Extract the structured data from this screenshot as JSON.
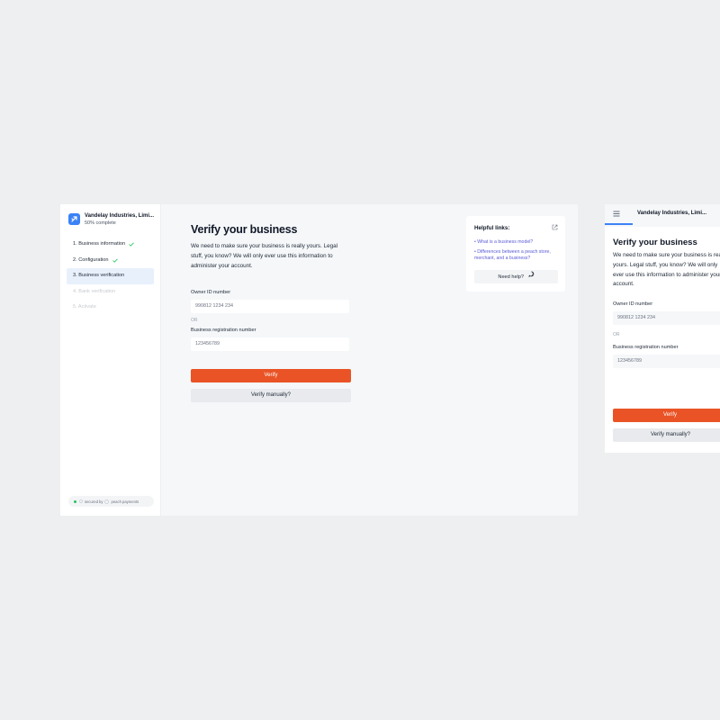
{
  "app": {
    "business_name": "Vandelay Industries, Limi...",
    "progress_text": "50% complete"
  },
  "steps": [
    {
      "label": "1.  Business information",
      "status": "complete"
    },
    {
      "label": "2.  Configuration",
      "status": "complete"
    },
    {
      "label": "3.  Business verification",
      "status": "active"
    },
    {
      "label": "4.  Bank verification",
      "status": "disabled"
    },
    {
      "label": "5.  Activate",
      "status": "disabled"
    }
  ],
  "footer": {
    "secured_by": "secured by",
    "provider": "peach payments"
  },
  "main": {
    "title": "Verify your business",
    "description": "We need to make sure your business is really yours. Legal stuff, you know? We will only ever use this information to administer your account.",
    "owner_id_label": "Owner ID number",
    "owner_id_placeholder": "990812 1234 234",
    "or_text": "OR",
    "registration_label": "Business registration number",
    "registration_placeholder": "123456789",
    "verify_label": "Verify",
    "verify_manually_label": "Verify manually?"
  },
  "help": {
    "title": "Helpful links:",
    "links": [
      "• What is a business model?",
      "• Differences between a peach store, merchant, and a business?"
    ],
    "need_help_label": "Need help?"
  },
  "mobile": {
    "brand": "Vandelay Industries, Limi...",
    "title": "Verify your business",
    "description": "We need to make sure your business is really yours. Legal stuff, you know? We will only ever use this information to administer your account.",
    "owner_id_label": "Owner ID number",
    "owner_id_placeholder": "990812 1234 234",
    "or_text": "OR",
    "registration_label": "Business registration number",
    "registration_placeholder": "123456789",
    "verify_label": "Verify",
    "verify_manually_label": "Verify manually?"
  },
  "colors": {
    "accent": "#ea5325",
    "brand_blue": "#3b82f6",
    "link": "#5b5bd6",
    "success": "#22c55e"
  },
  "icons": [
    "logo-icon",
    "check-icon",
    "lock-icon",
    "peach-icon",
    "external-link-icon",
    "chat-icon",
    "menu-icon"
  ]
}
